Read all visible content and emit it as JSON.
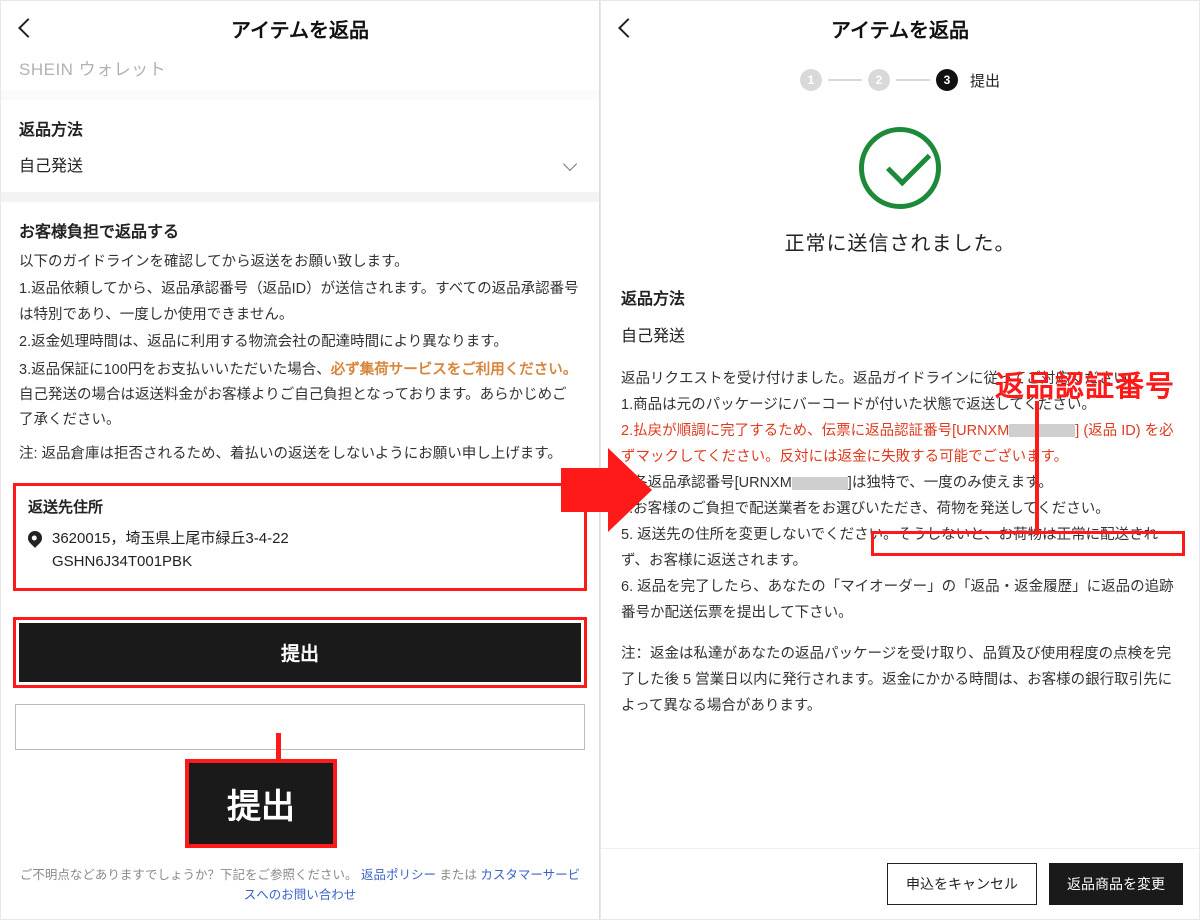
{
  "left": {
    "header_title": "アイテムを返品",
    "truncated_brand": "SHEIN ウォレット",
    "return_method_label": "返品方法",
    "return_method_value": "自己発送",
    "self_return_heading": "お客様負担で返品する",
    "intro": "以下のガイドラインを確認してから返送をお願い致します。",
    "g1": "1.返品依頼してから、返品承認番号（返品ID）が送信されます。すべての返品承認番号は特別であり、一度しか使用できません。",
    "g2": "2.返金処理時間は、返品に利用する物流会社の配達時間により異なります。",
    "g3_a": "3.返品保証に100円をお支払いいただいた場合、",
    "g3_b": "必ず集荷サービスをご利用ください。",
    "g3_c": "自己発送の場合は返送料金がお客様よりご自己負担となっております。あらかじめご了承ください。",
    "note": "注: 返品倉庫は拒否されるため、着払いの返送をしないようにお願い申し上げます。",
    "addr_heading": "返送先住所",
    "addr_line1": "3620015，埼玉県上尾市緑丘3-4-22",
    "addr_line2": "GSHN6J34T001PBK",
    "submit_label": "提出",
    "zoom_label": "提出",
    "footer_a": "ご不明点などありますでしょうか？下記をご参照ください。",
    "footer_link1": "返品ポリシー",
    "footer_mid": " または ",
    "footer_link2": "カスタマーサービスへのお問い合わせ"
  },
  "right": {
    "header_title": "アイテムを返品",
    "step1": "1",
    "step2": "2",
    "step3": "3",
    "step3_label": "提出",
    "success_msg": "正常に送信されました。",
    "return_method_label": "返品方法",
    "return_method_value": "自己発送",
    "p_intro": "返品リクエストを受け付けました。返品ガイドラインに従ってご対応ください。",
    "p1": "1.商品は元のパッケージにバーコードが付いた状態で返送してください。",
    "p2_a": "2.払戻が順調に完了するため、",
    "p2_b": "伝票に返品認証番号[URNXM",
    "p2_c": "] (返品 ID) を必ずマックしてください。反対には返金に失敗する可能でございます。",
    "p3_a": "3.各返品承認番号[URNXM",
    "p3_b": "]は独特で、一度のみ使えます。",
    "p4": "4.お客様のご負担で配送業者をお選びいただき、荷物を発送してください。",
    "p5": "5. 返送先の住所を変更しないでください。そうしないと、お荷物は正常に配送されず、お客様に返送されます。",
    "p6": "6. 返品を完了したら、あなたの「マイオーダー」の「返品・返金履歴」に返品の追跡番号か配送伝票を提出して下さい。",
    "p_note": "注：返金は私達があなたの返品パッケージを受け取り、品質及び使用程度の点検を完了した後 5 営業日以内に発行されます。返金にかかる時間は、お客様の銀行取引先によって異なる場合があります。",
    "btn_cancel": "申込をキャンセル",
    "btn_change": "返品商品を変更",
    "annotation_label": "返品認証番号"
  }
}
